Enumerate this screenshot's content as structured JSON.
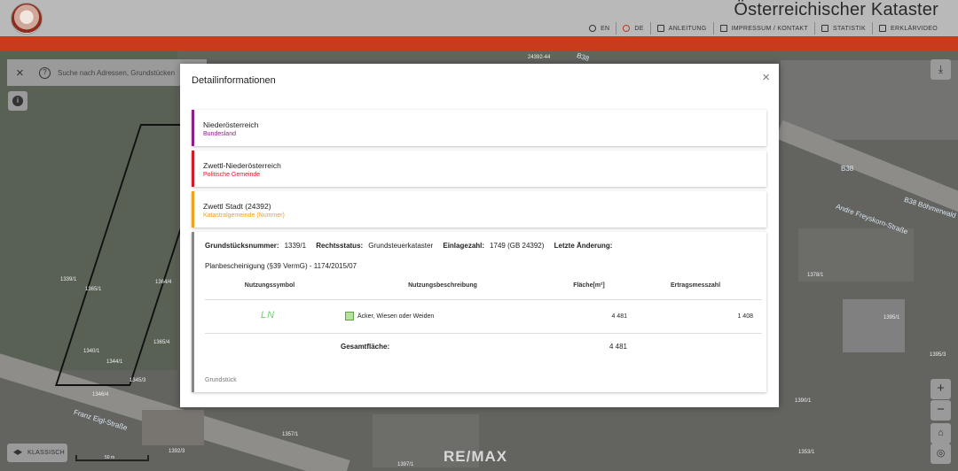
{
  "header": {
    "title": "Österreichischer Kataster",
    "nav": [
      {
        "label": "EN",
        "icon": "globe-icon"
      },
      {
        "label": "DE",
        "icon": "globe-icon"
      },
      {
        "label": "ANLEITUNG",
        "icon": "megaphone-icon"
      },
      {
        "label": "IMPRESSUM / KONTAKT",
        "icon": "contact-card-icon"
      },
      {
        "label": "STATISTIK",
        "icon": "bar-chart-icon"
      },
      {
        "label": "ERKLÄRVIDEO",
        "icon": "monitor-icon"
      }
    ],
    "accent_color": "#c83c19"
  },
  "search": {
    "placeholder": "Suche nach Adressen, Grundstücken"
  },
  "map": {
    "layer_button_label": "KLASSISCH",
    "scale_label": "50 m",
    "watermark": "RE/MAX",
    "streets": [
      "B38",
      "B38",
      "Andre Freyskorn-Straße",
      "B38 Böhmerwald",
      "Franz Eigl-Straße"
    ],
    "parcel_labels": [
      "1339/1",
      "1365/1",
      "1364/4",
      "1365/4",
      "1340/1",
      "1344/1",
      "1345/3",
      "1346/4",
      "1357/1",
      "1378/1",
      "1395/1",
      "1395/3",
      "1390/1",
      "1397/1",
      "1392/3",
      "1367/1",
      "24392-44",
      "1353/1"
    ]
  },
  "modal": {
    "title": "Detailinformationen",
    "cards": [
      {
        "main": "Niederösterreich",
        "sub": "Bundesland",
        "color": "#8e1f88"
      },
      {
        "main": "Zwettl-Niederösterreich",
        "sub": "Politische Gemeinde",
        "color": "#d01c28"
      },
      {
        "main": "Zwettl Stadt (24392)",
        "sub": "Katastralgemeinde (Nummer)",
        "color": "#f0a11a"
      }
    ],
    "detail": {
      "grundstuecksnummer_label": "Grundstücksnummer:",
      "grundstuecksnummer": "1339/1",
      "rechtsstatus_label": "Rechtsstatus:",
      "rechtsstatus": "Grundsteuerkataster",
      "einlagezahl_label": "Einlagezahl:",
      "einlagezahl": "1749 (GB 24392)",
      "letzte_aenderung_label": "Letzte Änderung:",
      "plan": "Planbescheinigung (§39 VermG) - 1174/2015/07",
      "columns": [
        "Nutzungssymbol",
        "Nutzungsbeschreibung",
        "Fläche[m²]",
        "Ertragsmesszahl"
      ],
      "rows": [
        {
          "symbol": "LN",
          "beschreibung": "Äcker, Wiesen oder Weiden",
          "flaeche": "4 481",
          "ertragsmesszahl": "1 408",
          "swatch": "#b6e39c"
        }
      ],
      "gesamt_label": "Gesamtfläche:",
      "gesamt_value": "4 481",
      "footer": "Grundstück"
    }
  }
}
